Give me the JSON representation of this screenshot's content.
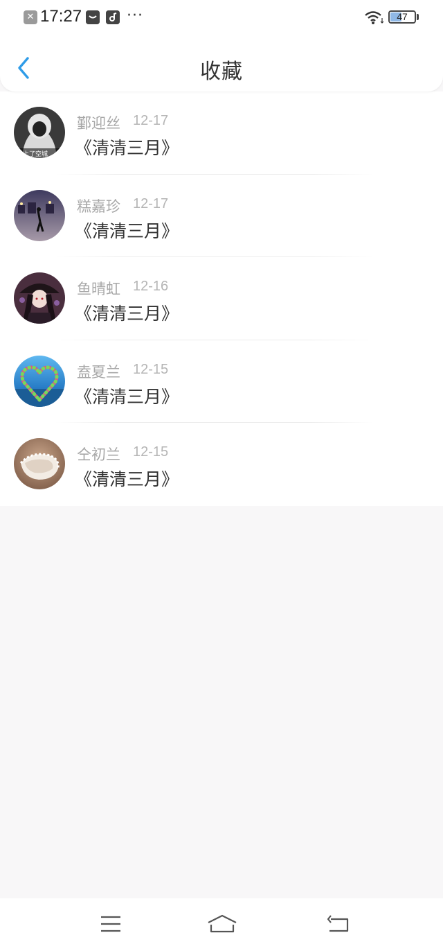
{
  "status_bar": {
    "time": "17:27",
    "battery": "47",
    "battery_level": 0.47,
    "icons": [
      "notification-close-icon",
      "message-icon",
      "music-icon",
      "more-dots-icon",
      "wifi-icon",
      "battery-icon"
    ]
  },
  "header": {
    "title": "收藏",
    "back_icon": "chevron-left-icon"
  },
  "colors": {
    "accent": "#2f9ce8",
    "background": "#f8f7f8",
    "name_gray": "#a8a8a8",
    "title_text": "#333333"
  },
  "favorites": [
    {
      "name": "鄞迎丝",
      "date": "12-17",
      "title": "《清清三月》"
    },
    {
      "name": "糕嘉珍",
      "date": "12-17",
      "title": "《清清三月》"
    },
    {
      "name": "鱼晴虹",
      "date": "12-16",
      "title": "《清清三月》"
    },
    {
      "name": "盍夏兰",
      "date": "12-15",
      "title": "《清清三月》"
    },
    {
      "name": "仝初兰",
      "date": "12-15",
      "title": "《清清三月》"
    }
  ],
  "bottom_nav": {
    "icons": [
      "menu-icon",
      "home-icon",
      "back-return-icon"
    ]
  }
}
